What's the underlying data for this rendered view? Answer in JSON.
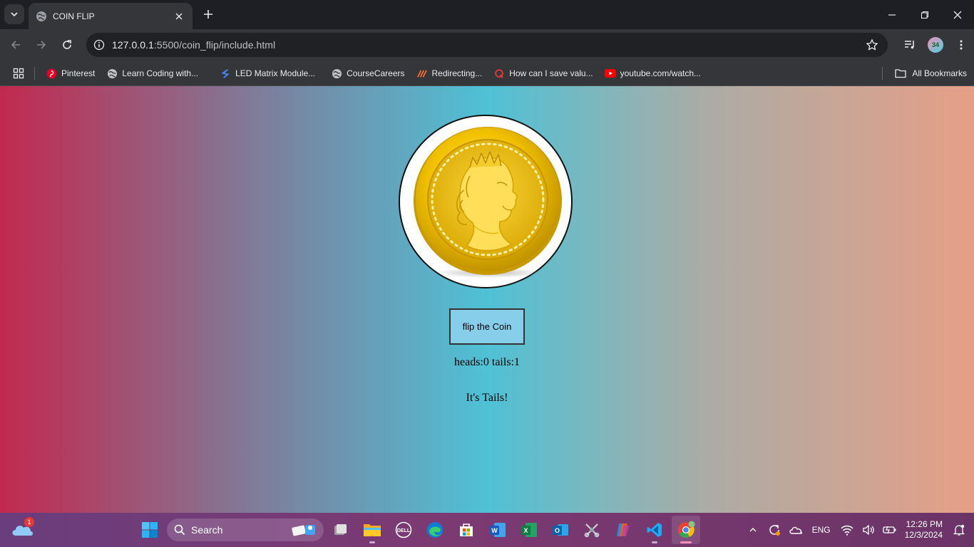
{
  "browser": {
    "tab_title": "COIN FLIP",
    "url_host": "127.0.0.1",
    "url_path": ":5500/coin_flip/include.html",
    "bookmarks": [
      {
        "label": "Pinterest",
        "icon": "pinterest-icon"
      },
      {
        "label": "Learn Coding with...",
        "icon": "globe-icon"
      },
      {
        "label": "LED Matrix Module...",
        "icon": "blue-s-icon"
      },
      {
        "label": "CourseCareers",
        "icon": "globe-icon"
      },
      {
        "label": "Redirecting...",
        "icon": "orange-slash-icon"
      },
      {
        "label": "How can I save valu...",
        "icon": "quora-icon"
      },
      {
        "label": "youtube.com/watch...",
        "icon": "youtube-icon"
      }
    ],
    "all_bookmarks_label": "All Bookmarks",
    "profile_initials": "34"
  },
  "page": {
    "button_label": "flip the Coin",
    "score_text": "heads:0 tails:1",
    "result_text": "It's Tails!",
    "coin_image": "gold-coin-queen-profile",
    "colors": {
      "gradient_left": "#c2294f",
      "gradient_mid": "#4fc1d6",
      "gradient_right": "#e69f86",
      "button_bg": "#87ceeb"
    }
  },
  "taskbar": {
    "weather_badge": "1",
    "search_label": "Search",
    "language": "ENG",
    "time": "12:26 PM",
    "date": "12/3/2024",
    "pinned": [
      "windows-start-icon",
      "file-explorer-icon",
      "dell-icon",
      "edge-icon",
      "store-icon",
      "word-icon",
      "excel-icon",
      "outlook-icon",
      "snipping-icon",
      "copilot-icon",
      "vscode-icon",
      "chrome-icon"
    ]
  }
}
